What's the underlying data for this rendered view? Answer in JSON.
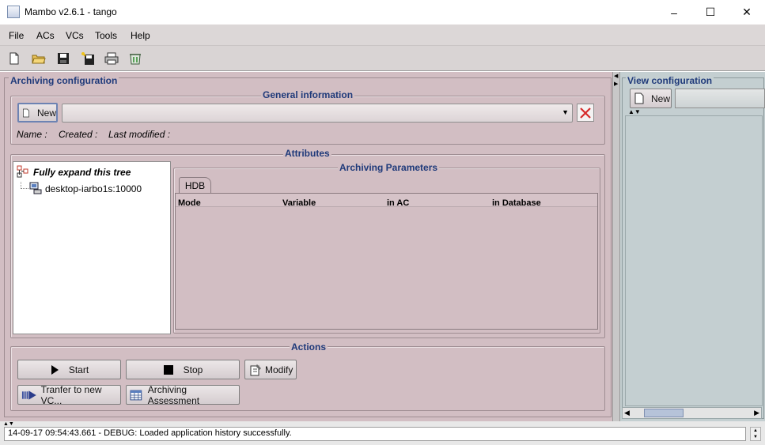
{
  "window": {
    "title": "Mambo v2.6.1 - tango",
    "minimize": "–",
    "maximize": "☐",
    "close": "✕"
  },
  "menu": [
    "File",
    "ACs",
    "VCs",
    "Tools",
    "Help"
  ],
  "toolbar_icons": [
    "new-file-icon",
    "open-folder-icon",
    "save-icon",
    "save-all-icon",
    "print-icon",
    "trash-icon"
  ],
  "archiving": {
    "title": "Archiving configuration",
    "general_info": "General information",
    "new_label": "New",
    "name_label": "Name :",
    "created_label": "Created :",
    "modified_label": "Last modified :",
    "attributes_title": "Attributes",
    "tree_root": "Fully expand this tree",
    "tree_node": "desktop-iarbo1s:10000",
    "params_title": "Archiving Parameters",
    "tab_hdb": "HDB",
    "columns": [
      "Mode",
      "Variable",
      "in AC",
      "in Database"
    ],
    "actions_title": "Actions",
    "start": "Start",
    "stop": "Stop",
    "modify": "Modify",
    "transfer": "Tranfer to new VC...",
    "assessment": "Archiving Assessment"
  },
  "view": {
    "title": "View configuration",
    "new_label": "New"
  },
  "status": {
    "message": "14-09-17 09:54:43.661 - DEBUG: Loaded application history successfully."
  },
  "colors": {
    "left_panel": "#d2bec3",
    "right_panel": "#c4cfd1",
    "title_accent": "#1f3a7a",
    "close_red": "#d62a2a"
  }
}
